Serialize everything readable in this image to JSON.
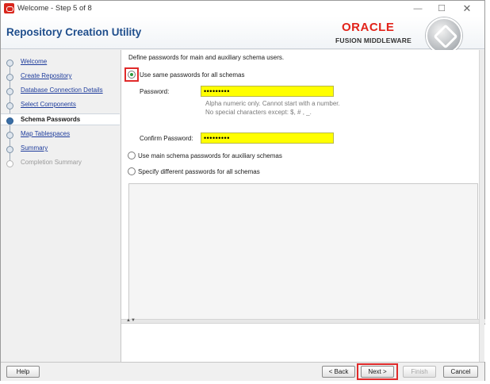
{
  "window": {
    "title": "Welcome - Step 5 of 8",
    "min_glyph": "—",
    "max_glyph": "☐",
    "close_glyph": "✕"
  },
  "header": {
    "app_title": "Repository Creation Utility",
    "brand": "ORACLE",
    "brand_sub": "FUSION MIDDLEWARE"
  },
  "nav": {
    "items": [
      {
        "label": "Welcome",
        "state": "done"
      },
      {
        "label": "Create Repository",
        "state": "done"
      },
      {
        "label": "Database Connection Details",
        "state": "done"
      },
      {
        "label": "Select Components",
        "state": "done"
      },
      {
        "label": "Schema Passwords",
        "state": "current"
      },
      {
        "label": "Map Tablespaces",
        "state": "done"
      },
      {
        "label": "Summary",
        "state": "done"
      },
      {
        "label": "Completion Summary",
        "state": "future"
      }
    ]
  },
  "main": {
    "intro": "Define passwords for main and auxiliary schema users.",
    "option_same": "Use same passwords for all schemas",
    "password_label": "Password:",
    "password_value": "•••••••••",
    "hint_line1": "Alpha numeric only. Cannot start with a number.",
    "hint_line2": "No special characters except: $, # , _.",
    "confirm_label": "Confirm Password:",
    "confirm_value": "•••••••••",
    "option_main_aux": "Use main schema passwords for auxiliary schemas",
    "option_different": "Specify different passwords for all schemas",
    "selected_option": "same"
  },
  "buttons": {
    "help": "Help",
    "back": "< Back",
    "next": "Next >",
    "finish": "Finish",
    "cancel": "Cancel"
  },
  "colors": {
    "accent": "#1f4e8c",
    "brand_red": "#e2231a",
    "field_highlight": "#ffff00",
    "callout": "#e02a2a"
  }
}
